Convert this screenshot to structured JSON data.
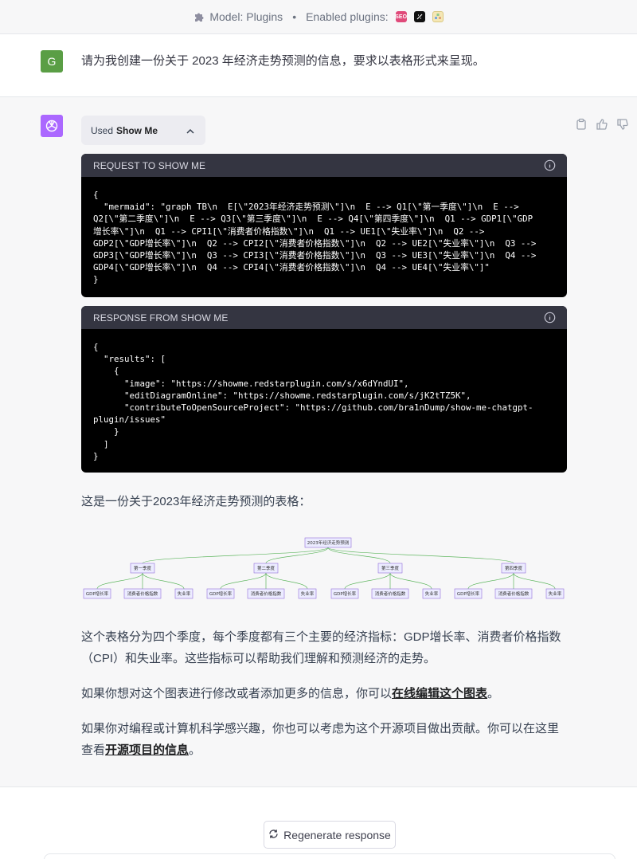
{
  "topbar": {
    "model_label": "Model: Plugins",
    "separator": "•",
    "plugins_label": "Enabled plugins:",
    "plugins": [
      {
        "name": "SEO",
        "color": "#e04a7a"
      },
      {
        "name": "wolfram",
        "color": "#111111"
      },
      {
        "name": "show-me",
        "color": "#f5e7b5"
      }
    ]
  },
  "user": {
    "avatar_letter": "G",
    "avatar_color": "#5a9e45",
    "message": "请为我创建一份关于 2023 年经济走势预测的信息，要求以表格形式来呈现。"
  },
  "assistant": {
    "avatar_color": "#ab68ff",
    "used_prefix": "Used",
    "used_plugin": "Show Me",
    "request_title": "REQUEST TO SHOW ME",
    "request_body": "{\n  \"mermaid\": \"graph TB\\n  E[\\\"2023年经济走势预测\\\"]\\n  E --> Q1[\\\"第一季度\\\"]\\n  E -->\nQ2[\\\"第二季度\\\"]\\n  E --> Q3[\\\"第三季度\\\"]\\n  E --> Q4[\\\"第四季度\\\"]\\n  Q1 --> GDP1[\\\"GDP\n增长率\\\"]\\n  Q1 --> CPI1[\\\"消费者价格指数\\\"]\\n  Q1 --> UE1[\\\"失业率\\\"]\\n  Q2 -->\nGDP2[\\\"GDP增长率\\\"]\\n  Q2 --> CPI2[\\\"消费者价格指数\\\"]\\n  Q2 --> UE2[\\\"失业率\\\"]\\n  Q3 -->\nGDP3[\\\"GDP增长率\\\"]\\n  Q3 --> CPI3[\\\"消费者价格指数\\\"]\\n  Q3 --> UE3[\\\"失业率\\\"]\\n  Q4 -->\nGDP4[\\\"GDP增长率\\\"]\\n  Q4 --> CPI4[\\\"消费者价格指数\\\"]\\n  Q4 --> UE4[\\\"失业率\\\"]\"\n}",
    "response_title": "RESPONSE FROM SHOW ME",
    "response_body": "{\n  \"results\": [\n    {\n      \"image\": \"https://showme.redstarplugin.com/s/x6dYndUI\",\n      \"editDiagramOnline\": \"https://showme.redstarplugin.com/s/jK2tTZ5K\",\n      \"contributeToOpenSourceProject\": \"https://github.com/bra1nDump/show-me-chatgpt-\nplugin/issues\"\n    }\n  ]\n}",
    "intro": "这是一份关于2023年经济走势预测的表格：",
    "diagram": {
      "root": "2023年经济走势预测",
      "quarters": [
        {
          "label": "第一季度",
          "children": [
            "GDP增长率",
            "消费者价格指数",
            "失业率"
          ]
        },
        {
          "label": "第二季度",
          "children": [
            "GDP增长率",
            "消费者价格指数",
            "失业率"
          ]
        },
        {
          "label": "第三季度",
          "children": [
            "GDP增长率",
            "消费者价格指数",
            "失业率"
          ]
        },
        {
          "label": "第四季度",
          "children": [
            "GDP增长率",
            "消费者价格指数",
            "失业率"
          ]
        }
      ]
    },
    "p1": "这个表格分为四个季度，每个季度都有三个主要的经济指标：GDP增长率、消费者价格指数（CPI）和失业率。这些指标可以帮助我们理解和预测经济的走势。",
    "p2_before": "如果你想对这个图表进行修改或者添加更多的信息，你可以",
    "p2_link": "在线编辑这个图表",
    "p2_after": "。",
    "p3_before": "如果你对编程或计算机科学感兴趣，你也可以考虑为这个开源项目做出贡献。你可以在这里查看",
    "p3_link": "开源项目的信息",
    "p3_after": "。"
  },
  "footer": {
    "regenerate_label": "Regenerate response"
  }
}
